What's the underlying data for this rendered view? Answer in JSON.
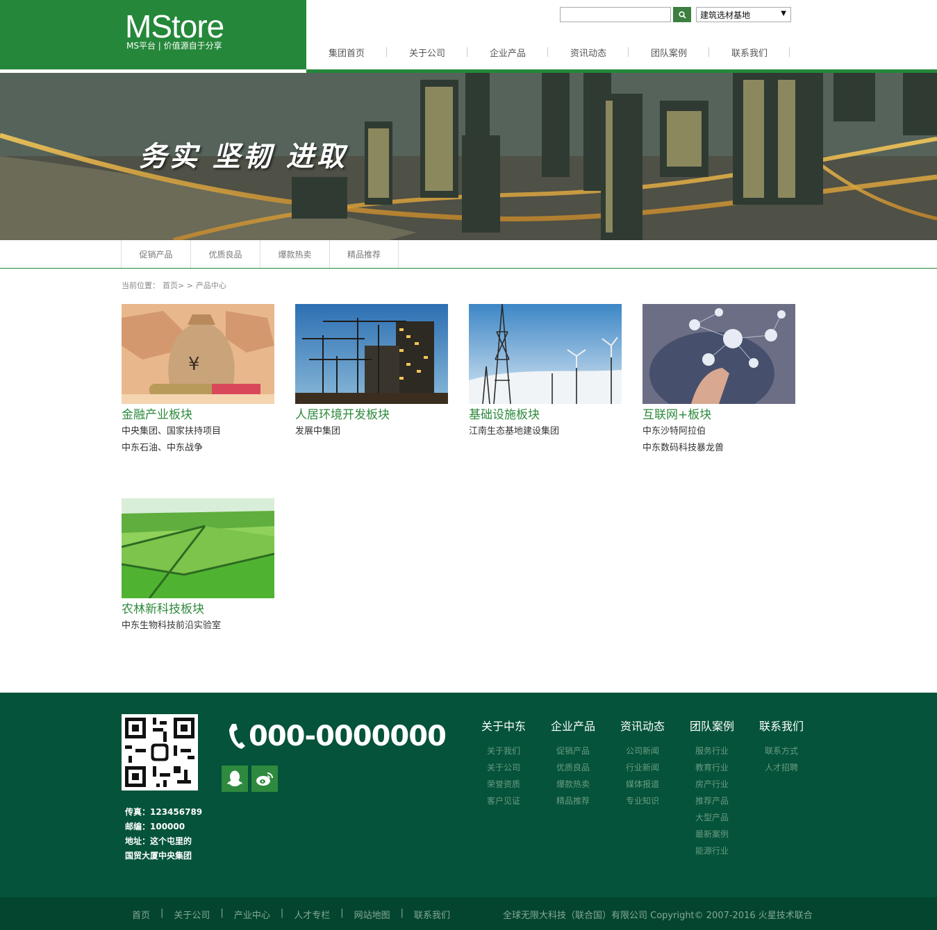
{
  "logo": {
    "title": "MStore",
    "subtitle": "MS平台 | 价值源自于分享"
  },
  "search": {
    "value": "",
    "button_icon": "search-icon",
    "select_value": "建筑选材基地"
  },
  "nav": [
    "集团首页",
    "关于公司",
    "企业产品",
    "资讯动态",
    "团队案例",
    "联系我们"
  ],
  "banner": {
    "slogan": "务实  坚韧  进取"
  },
  "subtabs": [
    "促销产品",
    "优质良品",
    "爆款热卖",
    "精品推荐"
  ],
  "breadcrumb": {
    "label": "当前位置：",
    "home": "首页>",
    "sep": ">",
    "current": "产品中心"
  },
  "products": [
    {
      "title": "金融产业板块",
      "lines": [
        "中央集团、国家扶持项目",
        "中东石油、中东战争"
      ]
    },
    {
      "title": "人居环境开发板块",
      "lines": [
        "发展中集团"
      ]
    },
    {
      "title": "基础设施板块",
      "lines": [
        "江南生态基地建设集团"
      ]
    },
    {
      "title": "互联网+板块",
      "lines": [
        "中东沙特阿拉伯",
        "中东数码科技暴龙兽"
      ]
    },
    {
      "title": "农林新科技板块",
      "lines": [
        "中东生物科技前沿实验室"
      ]
    }
  ],
  "footer": {
    "phone": "000-0000000",
    "contact": {
      "fax": "传真：123456789",
      "zip": "邮编：100000",
      "address1": "地址：这个屯里的",
      "address2": "国贸大厦中央集团"
    },
    "columns": [
      {
        "title": "关于中东",
        "items": [
          "关于我们",
          "关于公司",
          "荣誉资质",
          "客户见证"
        ]
      },
      {
        "title": "企业产品",
        "items": [
          "促销产品",
          "优质良品",
          "爆款热卖",
          "精品推荐"
        ]
      },
      {
        "title": "资讯动态",
        "items": [
          "公司新闻",
          "行业新闻",
          "媒体报道",
          "专业知识"
        ]
      },
      {
        "title": "团队案例",
        "items": [
          "服务行业",
          "教育行业",
          "房产行业",
          "推荐产品",
          "大型产品",
          "最新案例",
          "能源行业"
        ]
      },
      {
        "title": "联系我们",
        "items": [
          "联系方式",
          "人才招聘"
        ]
      }
    ],
    "bottom_links": [
      "首页",
      "关于公司",
      "产业中心",
      "人才专栏",
      "网站地图",
      "联系我们"
    ],
    "copyright": "全球无限大科技（联合国）有限公司 Copyright© 2007-2016 火星技术联合"
  },
  "colors": {
    "brand_green": "#25873a",
    "footer_green": "#04533a",
    "title_green": "#2d8a3c"
  }
}
